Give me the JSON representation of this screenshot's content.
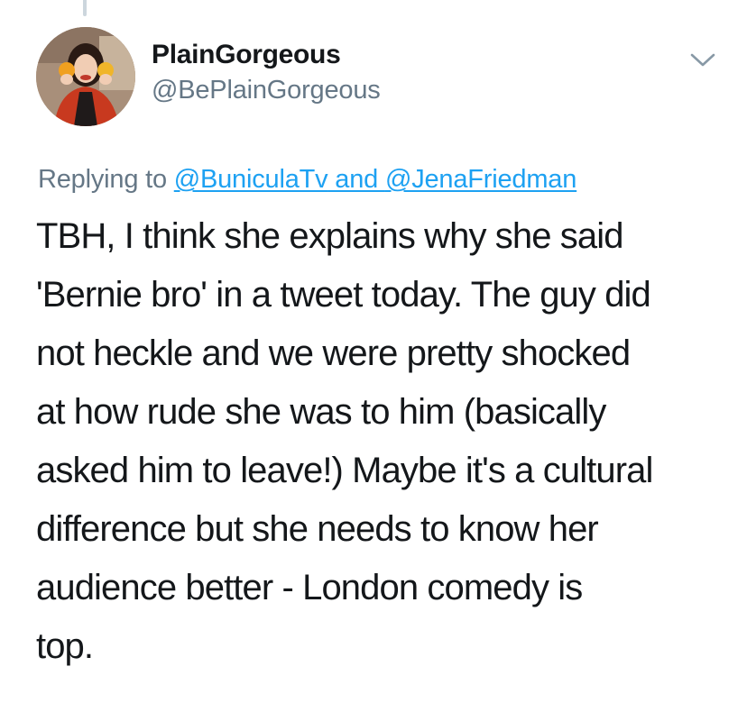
{
  "author": {
    "display_name": "PlainGorgeous",
    "handle": "@BePlainGorgeous",
    "avatar_icon": "profile-photo"
  },
  "menu": {
    "icon": "chevron-down-icon"
  },
  "reply_context": {
    "prefix": "Replying to ",
    "mention_1": "@BuniculaTv",
    "separator": " and ",
    "mention_2": "@JenaFriedman",
    "link_color": "#1da1f2"
  },
  "tweet": {
    "lines": [
      "TBH, I think she explains why she said",
      "'Bernie bro' in a tweet today. The guy did",
      "not heckle and we were pretty shocked",
      "at how rude she was to him (basically",
      "asked him to leave!) Maybe it's a cultural",
      "difference but she needs to know her",
      "audience better - London comedy is",
      "top."
    ]
  }
}
